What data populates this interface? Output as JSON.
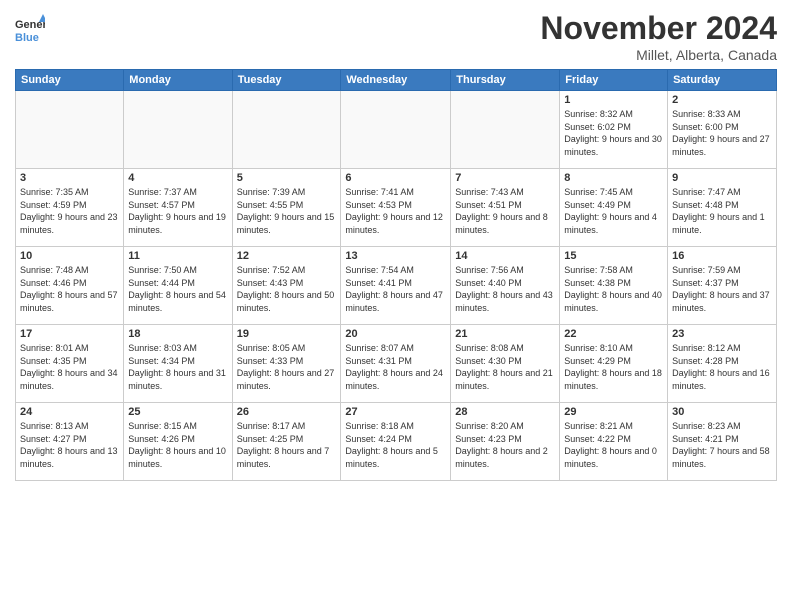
{
  "header": {
    "logo_line1": "General",
    "logo_line2": "Blue",
    "month": "November 2024",
    "location": "Millet, Alberta, Canada"
  },
  "days_of_week": [
    "Sunday",
    "Monday",
    "Tuesday",
    "Wednesday",
    "Thursday",
    "Friday",
    "Saturday"
  ],
  "weeks": [
    [
      {
        "day": "",
        "info": ""
      },
      {
        "day": "",
        "info": ""
      },
      {
        "day": "",
        "info": ""
      },
      {
        "day": "",
        "info": ""
      },
      {
        "day": "",
        "info": ""
      },
      {
        "day": "1",
        "info": "Sunrise: 8:32 AM\nSunset: 6:02 PM\nDaylight: 9 hours and 30 minutes."
      },
      {
        "day": "2",
        "info": "Sunrise: 8:33 AM\nSunset: 6:00 PM\nDaylight: 9 hours and 27 minutes."
      }
    ],
    [
      {
        "day": "3",
        "info": "Sunrise: 7:35 AM\nSunset: 4:59 PM\nDaylight: 9 hours and 23 minutes."
      },
      {
        "day": "4",
        "info": "Sunrise: 7:37 AM\nSunset: 4:57 PM\nDaylight: 9 hours and 19 minutes."
      },
      {
        "day": "5",
        "info": "Sunrise: 7:39 AM\nSunset: 4:55 PM\nDaylight: 9 hours and 15 minutes."
      },
      {
        "day": "6",
        "info": "Sunrise: 7:41 AM\nSunset: 4:53 PM\nDaylight: 9 hours and 12 minutes."
      },
      {
        "day": "7",
        "info": "Sunrise: 7:43 AM\nSunset: 4:51 PM\nDaylight: 9 hours and 8 minutes."
      },
      {
        "day": "8",
        "info": "Sunrise: 7:45 AM\nSunset: 4:49 PM\nDaylight: 9 hours and 4 minutes."
      },
      {
        "day": "9",
        "info": "Sunrise: 7:47 AM\nSunset: 4:48 PM\nDaylight: 9 hours and 1 minute."
      }
    ],
    [
      {
        "day": "10",
        "info": "Sunrise: 7:48 AM\nSunset: 4:46 PM\nDaylight: 8 hours and 57 minutes."
      },
      {
        "day": "11",
        "info": "Sunrise: 7:50 AM\nSunset: 4:44 PM\nDaylight: 8 hours and 54 minutes."
      },
      {
        "day": "12",
        "info": "Sunrise: 7:52 AM\nSunset: 4:43 PM\nDaylight: 8 hours and 50 minutes."
      },
      {
        "day": "13",
        "info": "Sunrise: 7:54 AM\nSunset: 4:41 PM\nDaylight: 8 hours and 47 minutes."
      },
      {
        "day": "14",
        "info": "Sunrise: 7:56 AM\nSunset: 4:40 PM\nDaylight: 8 hours and 43 minutes."
      },
      {
        "day": "15",
        "info": "Sunrise: 7:58 AM\nSunset: 4:38 PM\nDaylight: 8 hours and 40 minutes."
      },
      {
        "day": "16",
        "info": "Sunrise: 7:59 AM\nSunset: 4:37 PM\nDaylight: 8 hours and 37 minutes."
      }
    ],
    [
      {
        "day": "17",
        "info": "Sunrise: 8:01 AM\nSunset: 4:35 PM\nDaylight: 8 hours and 34 minutes."
      },
      {
        "day": "18",
        "info": "Sunrise: 8:03 AM\nSunset: 4:34 PM\nDaylight: 8 hours and 31 minutes."
      },
      {
        "day": "19",
        "info": "Sunrise: 8:05 AM\nSunset: 4:33 PM\nDaylight: 8 hours and 27 minutes."
      },
      {
        "day": "20",
        "info": "Sunrise: 8:07 AM\nSunset: 4:31 PM\nDaylight: 8 hours and 24 minutes."
      },
      {
        "day": "21",
        "info": "Sunrise: 8:08 AM\nSunset: 4:30 PM\nDaylight: 8 hours and 21 minutes."
      },
      {
        "day": "22",
        "info": "Sunrise: 8:10 AM\nSunset: 4:29 PM\nDaylight: 8 hours and 18 minutes."
      },
      {
        "day": "23",
        "info": "Sunrise: 8:12 AM\nSunset: 4:28 PM\nDaylight: 8 hours and 16 minutes."
      }
    ],
    [
      {
        "day": "24",
        "info": "Sunrise: 8:13 AM\nSunset: 4:27 PM\nDaylight: 8 hours and 13 minutes."
      },
      {
        "day": "25",
        "info": "Sunrise: 8:15 AM\nSunset: 4:26 PM\nDaylight: 8 hours and 10 minutes."
      },
      {
        "day": "26",
        "info": "Sunrise: 8:17 AM\nSunset: 4:25 PM\nDaylight: 8 hours and 7 minutes."
      },
      {
        "day": "27",
        "info": "Sunrise: 8:18 AM\nSunset: 4:24 PM\nDaylight: 8 hours and 5 minutes."
      },
      {
        "day": "28",
        "info": "Sunrise: 8:20 AM\nSunset: 4:23 PM\nDaylight: 8 hours and 2 minutes."
      },
      {
        "day": "29",
        "info": "Sunrise: 8:21 AM\nSunset: 4:22 PM\nDaylight: 8 hours and 0 minutes."
      },
      {
        "day": "30",
        "info": "Sunrise: 8:23 AM\nSunset: 4:21 PM\nDaylight: 7 hours and 58 minutes."
      }
    ]
  ]
}
